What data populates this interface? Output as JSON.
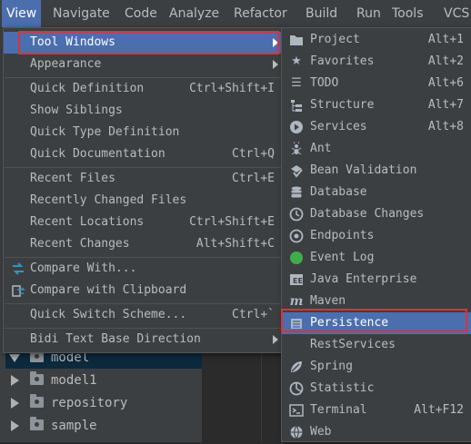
{
  "menubar": {
    "items": [
      {
        "name": "view",
        "label": "View"
      },
      {
        "name": "navigate",
        "label": "Navigate"
      },
      {
        "name": "code",
        "label": "Code"
      },
      {
        "name": "analyze",
        "label": "Analyze"
      },
      {
        "name": "refactor",
        "label": "Refactor"
      },
      {
        "name": "build",
        "label": "Build"
      },
      {
        "name": "run",
        "label": "Run"
      },
      {
        "name": "tools",
        "label": "Tools"
      },
      {
        "name": "vcs",
        "label": "VCS"
      }
    ]
  },
  "view_menu": {
    "items": [
      {
        "label": "Tool Windows",
        "shortcut": "",
        "submenu": true,
        "highlighted": true
      },
      {
        "label": "Appearance",
        "shortcut": "",
        "submenu": true
      },
      {
        "label": "Quick Definition",
        "shortcut": "Ctrl+Shift+I"
      },
      {
        "label": "Show Siblings",
        "shortcut": ""
      },
      {
        "label": "Quick Type Definition",
        "shortcut": ""
      },
      {
        "label": "Quick Documentation",
        "shortcut": "Ctrl+Q"
      },
      {
        "label": "Recent Files",
        "shortcut": "Ctrl+E"
      },
      {
        "label": "Recently Changed Files",
        "shortcut": ""
      },
      {
        "label": "Recent Locations",
        "shortcut": "Ctrl+Shift+E"
      },
      {
        "label": "Recent Changes",
        "shortcut": "Alt+Shift+C"
      },
      {
        "label": "Compare With...",
        "shortcut": "",
        "icon": "compare-arrows-icon"
      },
      {
        "label": "Compare with Clipboard",
        "shortcut": "",
        "icon": "clipboard-compare-icon"
      },
      {
        "label": "Quick Switch Scheme...",
        "shortcut": "Ctrl+`"
      },
      {
        "label": "Bidi Text Base Direction",
        "shortcut": "",
        "submenu": true
      }
    ]
  },
  "tool_windows_menu": {
    "items": [
      {
        "label": "Project",
        "shortcut": "Alt+1",
        "icon": "folder-icon"
      },
      {
        "label": "Favorites",
        "shortcut": "Alt+2",
        "icon": "star-icon"
      },
      {
        "label": "TODO",
        "shortcut": "Alt+6",
        "icon": "list-icon"
      },
      {
        "label": "Structure",
        "shortcut": "Alt+7",
        "icon": "structure-icon"
      },
      {
        "label": "Services",
        "shortcut": "Alt+8",
        "icon": "services-icon"
      },
      {
        "label": "Ant",
        "shortcut": "",
        "icon": "ant-icon"
      },
      {
        "label": "Bean Validation",
        "shortcut": "",
        "icon": "bean-validation-icon"
      },
      {
        "label": "Database",
        "shortcut": "",
        "icon": "database-icon"
      },
      {
        "label": "Database Changes",
        "shortcut": "",
        "icon": "database-changes-icon"
      },
      {
        "label": "Endpoints",
        "shortcut": "",
        "icon": "endpoints-icon"
      },
      {
        "label": "Event Log",
        "shortcut": "",
        "icon": "event-log-icon"
      },
      {
        "label": "Java Enterprise",
        "shortcut": "",
        "icon": "java-enterprise-icon"
      },
      {
        "label": "Maven",
        "shortcut": "",
        "icon": "maven-icon"
      },
      {
        "label": "Persistence",
        "shortcut": "",
        "icon": "persistence-icon",
        "highlighted": true
      },
      {
        "label": "RestServices",
        "shortcut": "",
        "icon": ""
      },
      {
        "label": "Spring",
        "shortcut": "",
        "icon": "spring-leaf-icon"
      },
      {
        "label": "Statistic",
        "shortcut": "",
        "icon": "statistic-icon"
      },
      {
        "label": "Terminal",
        "shortcut": "Alt+F12",
        "icon": "terminal-icon"
      },
      {
        "label": "Web",
        "shortcut": "",
        "icon": "web-globe-icon"
      }
    ]
  },
  "project_tree": {
    "items": [
      {
        "label": "model",
        "expanded": true,
        "selected": true
      },
      {
        "label": "model1",
        "expanded": false
      },
      {
        "label": "repository",
        "expanded": false
      },
      {
        "label": "sample",
        "expanded": false
      }
    ]
  },
  "colors": {
    "highlight": "#4b6eaf",
    "menu_bg": "#3c3f41",
    "annotation_box": "#e0303a",
    "event_log_green": "#3fae49"
  }
}
